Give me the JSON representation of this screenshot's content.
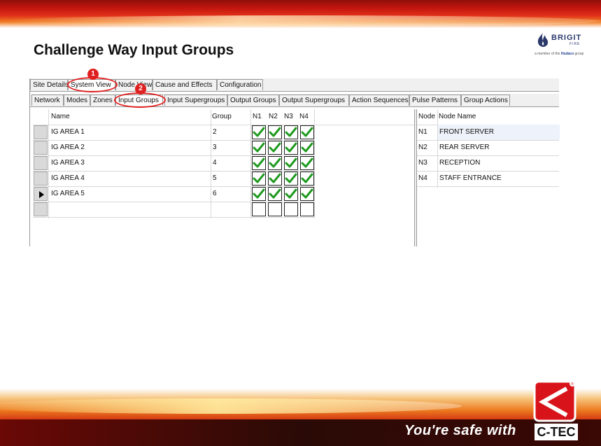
{
  "slide": {
    "title": "Challenge Way Input Groups",
    "tagline": "You're safe with",
    "ctec_label": "C-TEC",
    "ctec_reg": "®"
  },
  "logo": {
    "name": "BRIGIT",
    "sub": "FIRE",
    "member_prefix": "a member of the",
    "member_company": "Hudaco",
    "member_suffix": "group"
  },
  "tabs_main": [
    "Site Details",
    "System View",
    "Node View",
    "Cause and Effects",
    "Configuration"
  ],
  "tabs_sub": [
    "Network",
    "Modes",
    "Zones",
    "Input Groups",
    "Input Supergroups",
    "Output Groups",
    "Output Supergroups",
    "Action Sequences",
    "Pulse Patterns",
    "Group Actions"
  ],
  "annotations": [
    "1",
    "2"
  ],
  "grid": {
    "headers": {
      "name": "Name",
      "group": "Group",
      "n1": "N1",
      "n2": "N2",
      "n3": "N3",
      "n4": "N4"
    },
    "rows": [
      {
        "name": "IG AREA 1",
        "group": "2",
        "checks": [
          true,
          true,
          true,
          true
        ],
        "current": false
      },
      {
        "name": "IG AREA 2",
        "group": "3",
        "checks": [
          true,
          true,
          true,
          true
        ],
        "current": false
      },
      {
        "name": "IG AREA 3",
        "group": "4",
        "checks": [
          true,
          true,
          true,
          true
        ],
        "current": false
      },
      {
        "name": "IG AREA 4",
        "group": "5",
        "checks": [
          true,
          true,
          true,
          true
        ],
        "current": false
      },
      {
        "name": "IG AREA 5",
        "group": "6",
        "checks": [
          true,
          true,
          true,
          true
        ],
        "current": true
      },
      {
        "name": "",
        "group": "",
        "checks": [
          false,
          false,
          false,
          false
        ],
        "current": false
      }
    ]
  },
  "nodes": {
    "headers": {
      "node": "Node",
      "node_name": "Node Name"
    },
    "rows": [
      {
        "node": "N1",
        "name": "FRONT SERVER"
      },
      {
        "node": "N2",
        "name": "REAR SERVER"
      },
      {
        "node": "N3",
        "name": "RECEPTION"
      },
      {
        "node": "N4",
        "name": "STAFF ENTRANCE"
      }
    ]
  },
  "colors": {
    "accent_red": "#e02020",
    "check_green": "#1f9a1f",
    "brand_red": "#c4160e"
  }
}
